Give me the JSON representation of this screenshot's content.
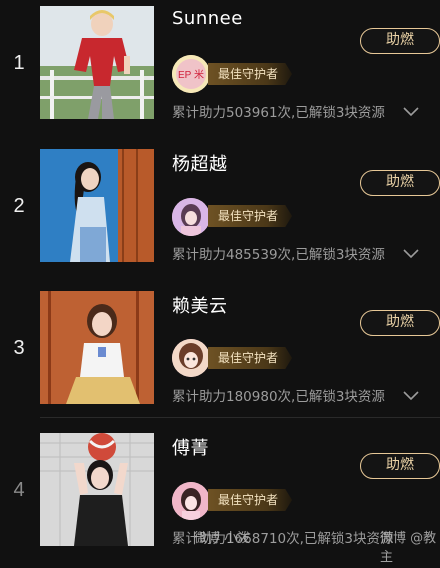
{
  "items": [
    {
      "rank": "1",
      "name": "Sunnee",
      "button": "助燃",
      "badge": "最佳守护者",
      "avatar_text": "EP 米",
      "stats": "累计助力503961次,已解锁3块资源"
    },
    {
      "rank": "2",
      "name": "杨超越",
      "button": "助燃",
      "badge": "最佳守护者",
      "stats": "累计助力485539次,已解锁3块资源"
    },
    {
      "rank": "3",
      "name": "赖美云",
      "button": "助燃",
      "badge": "最佳守护者",
      "stats": "累计助力180980次,已解锁3块资源"
    },
    {
      "rank": "4",
      "name": "傅菁",
      "button": "助燃",
      "badge": "最佳守护者",
      "stats": "累计助力1668710次,已解锁3块资源"
    }
  ],
  "watermark": {
    "left": "微博 小泼",
    "right": "微博 @教主"
  },
  "colors": {
    "accent": "#e7c897",
    "background": "#111111",
    "stat_text": "#9c9c9c"
  },
  "icons": {
    "expand": "chevron-down-icon"
  }
}
